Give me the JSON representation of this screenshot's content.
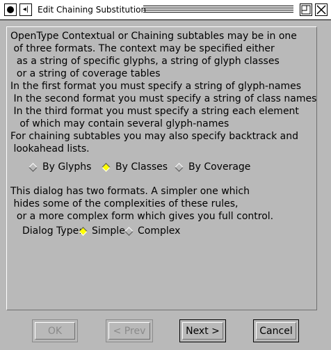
{
  "window": {
    "title": "Edit Chaining Substitution",
    "menu_glyph": "◂|"
  },
  "description": [
    "OpenType Contextual or Chaining subtables may be in one",
    " of three formats. The context may be specified either",
    "  as a string of specific glyphs, a string of glyph classes",
    "  or a string of coverage tables",
    "In the first format you must specify a string of glyph-names",
    " In the second format you must specify a string of class names",
    " In the third format you must specify a string each element",
    "   of which may contain several glyph-names",
    "For chaining subtables you may also specify backtrack and",
    " lookahead lists."
  ],
  "format_options": [
    {
      "label": "By Glyphs",
      "selected": false
    },
    {
      "label": "By Classes",
      "selected": true
    },
    {
      "label": "By Coverage",
      "selected": false
    }
  ],
  "dialog_text": [
    "This dialog has two formats. A simpler one which",
    " hides some of the complexities of these rules,",
    "  or a more complex form which gives you full control."
  ],
  "dialog_type": {
    "label": "Dialog Type:",
    "options": [
      {
        "label": "Simple",
        "selected": true
      },
      {
        "label": "Complex",
        "selected": false
      }
    ]
  },
  "buttons": {
    "ok": "OK",
    "prev": "< Prev",
    "next": "Next >",
    "cancel": "Cancel"
  },
  "colors": {
    "background": "#b9b9b9",
    "selected_radio": "#ffff00"
  }
}
